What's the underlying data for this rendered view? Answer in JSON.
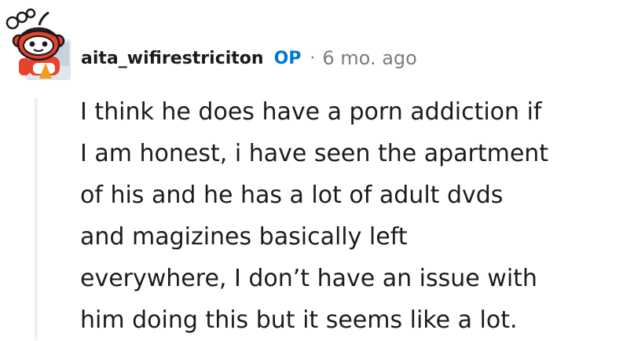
{
  "comment": {
    "author": "aita_wifirestriciton",
    "op_badge": "OP",
    "separator": "·",
    "timestamp": "6 mo. ago",
    "avatar_icon": "snoo-avatar-icon",
    "body_lines": [
      "I think he does have a porn addiction if",
      "I am honest, i have seen the apartment",
      "of his and he has a lot of adult dvds",
      "and magizines basically left",
      "everywhere, I don’t have an issue with",
      "him doing this but it seems like a lot."
    ]
  },
  "colors": {
    "text": "#1c1c1c",
    "op_accent": "#0079d3",
    "meta": "#7c7c7c",
    "thread_line": "#edeff1",
    "avatar_red": "#e8412c"
  }
}
